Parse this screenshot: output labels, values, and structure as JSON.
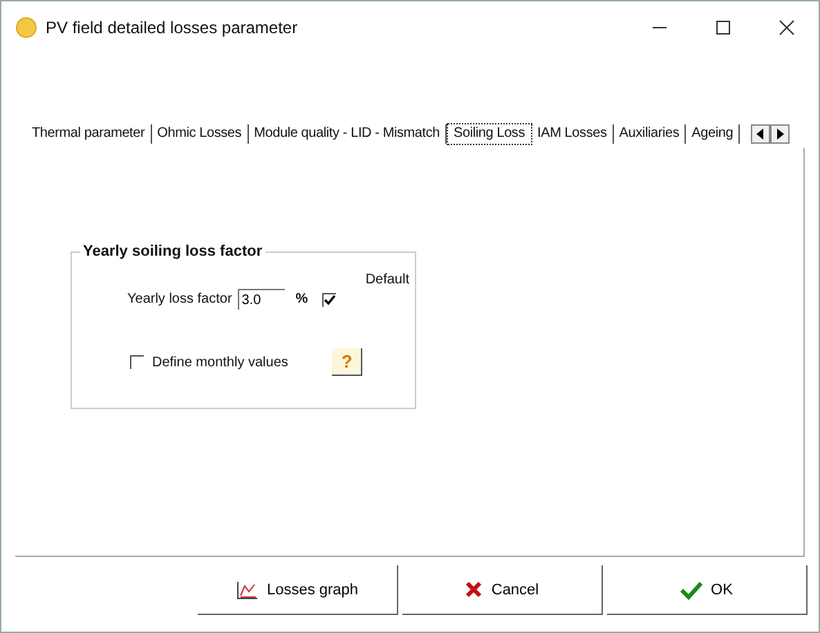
{
  "window": {
    "title": "PV field detailed losses parameter"
  },
  "tabs": [
    {
      "label": "Thermal parameter",
      "selected": false
    },
    {
      "label": "Ohmic Losses",
      "selected": false
    },
    {
      "label": "Module quality - LID - Mismatch",
      "selected": false
    },
    {
      "label": "Soiling Loss",
      "selected": true
    },
    {
      "label": "IAM Losses",
      "selected": false
    },
    {
      "label": "Auxiliaries",
      "selected": false
    },
    {
      "label": "Ageing",
      "selected": false
    }
  ],
  "group": {
    "title": "Yearly soiling loss factor",
    "default_label": "Default",
    "field_label": "Yearly loss factor",
    "value": "3.0",
    "unit": "%",
    "default_checked": true,
    "monthly_label": "Define monthly values",
    "monthly_checked": false,
    "help": "?"
  },
  "buttons": [
    {
      "kind": "graph",
      "label": "Losses graph"
    },
    {
      "kind": "cancel",
      "label": "Cancel"
    },
    {
      "kind": "ok",
      "label": "OK"
    }
  ]
}
